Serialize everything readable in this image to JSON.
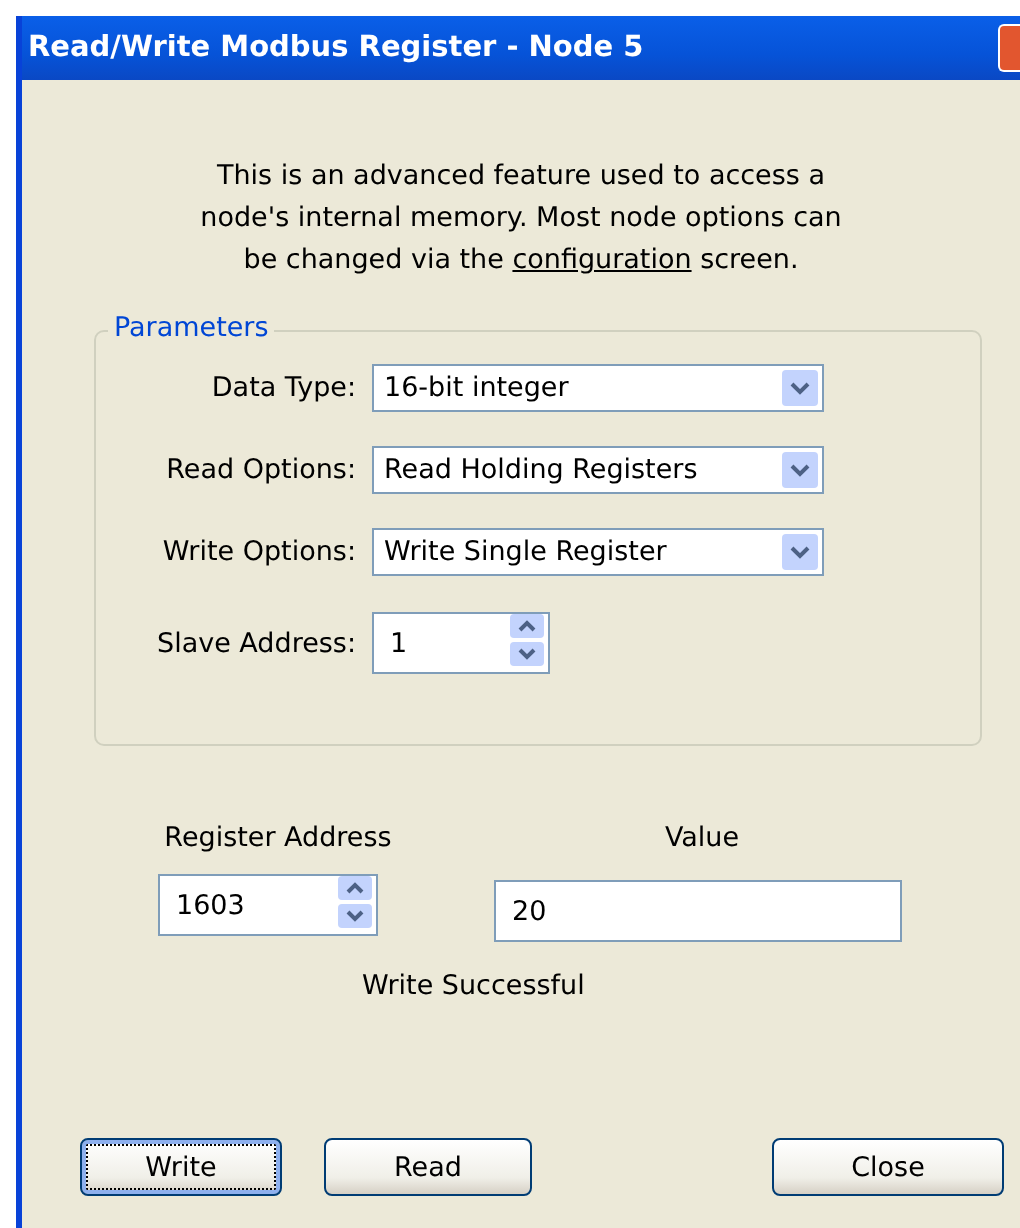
{
  "window": {
    "title": "Read/Write Modbus Register - Node 5"
  },
  "intro": {
    "before": "This is an advanced feature used to access a node's internal memory. Most node options can be changed via the ",
    "link": "configuration",
    "after": " screen."
  },
  "parameters": {
    "title": "Parameters",
    "dropdowns": [
      {
        "label": "Data Type:",
        "value": "16-bit integer"
      },
      {
        "label": "Read Options:",
        "value": "Read Holding Registers"
      },
      {
        "label": "Write Options:",
        "value": "Write Single Register"
      }
    ],
    "slave_address": {
      "label": "Slave Address:",
      "value": "1"
    }
  },
  "register_address": {
    "label": "Register Address",
    "value": "1603"
  },
  "value": {
    "label": "Value",
    "value": "20"
  },
  "status": "Write Successful",
  "buttons": [
    {
      "label": "Write",
      "focused": true
    },
    {
      "label": "Read",
      "focused": false
    },
    {
      "label": "Close",
      "focused": false
    }
  ]
}
